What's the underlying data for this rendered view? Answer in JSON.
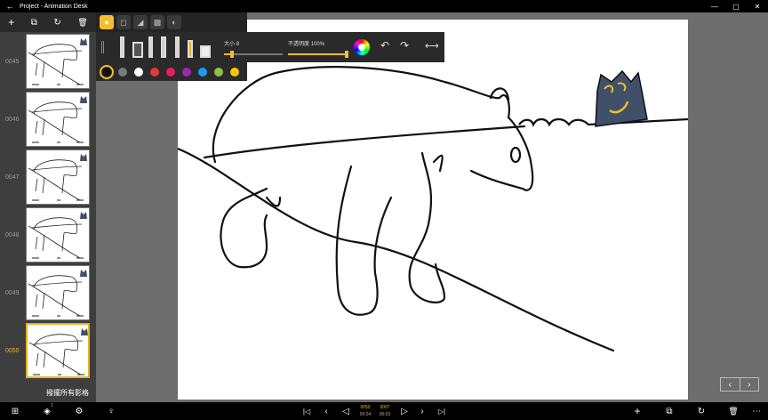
{
  "titlebar": {
    "back": "←",
    "title": "Project - Animation Desk",
    "minimize": "—",
    "maximize": "▢",
    "close": "✕"
  },
  "left_toolbar": {
    "add": "+",
    "duplicate": "⧉",
    "history": "↻",
    "delete": "🗑"
  },
  "frames": [
    {
      "number": "0045",
      "current": false
    },
    {
      "number": "0046",
      "current": false
    },
    {
      "number": "0047",
      "current": false
    },
    {
      "number": "0048",
      "current": false
    },
    {
      "number": "0049",
      "current": false
    },
    {
      "number": "0050",
      "current": true
    }
  ],
  "hint": "撥擺所有影格",
  "tools": {
    "size_label": "大小",
    "size_value": "8",
    "opacity_label": "不透明度",
    "opacity_value": "100%",
    "size_fraction": 0.13,
    "opacity_fraction": 1.0,
    "undo": "↶",
    "redo": "↷",
    "collapse": "⟷"
  },
  "colors": [
    "#111111",
    "#7a7a7a",
    "#ffffff",
    "#e53935",
    "#e91e63",
    "#9c27b0",
    "#2196f3",
    "#8bc34a",
    "#ffc107"
  ],
  "selected_color_index": 0,
  "bottom": {
    "grid": "⊞",
    "layers": "◈",
    "layers_badge": "1",
    "settings": "⚙",
    "tips": "♀",
    "first": "|◁",
    "prev_step": "‹",
    "prev": "◁",
    "current_frame": "0050",
    "current_total": "00:04",
    "next_frame": "0007",
    "next_total": "00:03",
    "play": "▷",
    "next_step": "›",
    "last": "▷|",
    "add": "+",
    "copy": "⧉",
    "history": "↻",
    "delete": "🗑",
    "more": "⋯"
  },
  "canvas_nav": {
    "prev": "‹",
    "next": "›"
  },
  "accent": "#f3bd2f"
}
